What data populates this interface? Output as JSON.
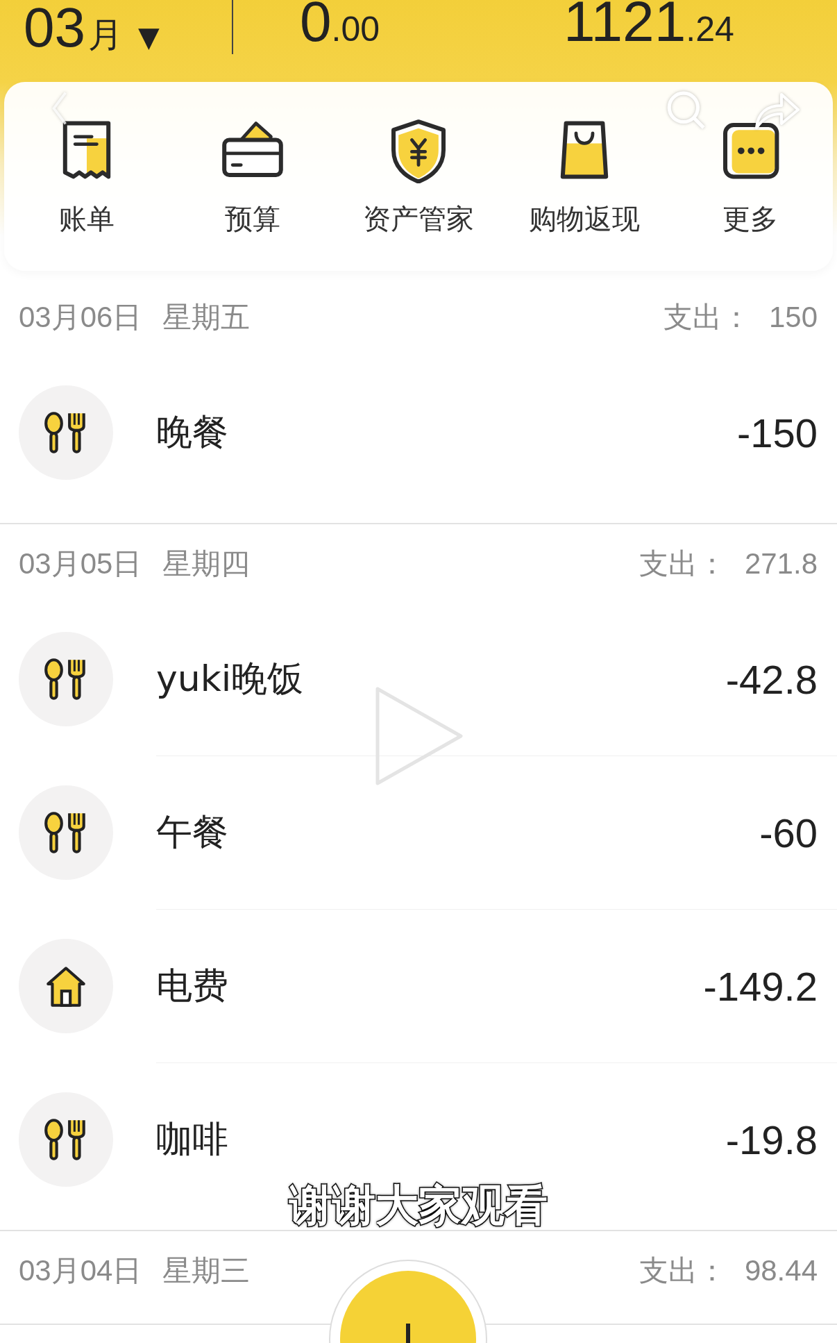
{
  "header": {
    "month": "03",
    "month_unit": "月",
    "caret": "▼",
    "income": {
      "int": "0",
      "dec": ".00"
    },
    "balance": {
      "int": "1121",
      "dec": ".24"
    }
  },
  "shortcuts": [
    {
      "label": "账单",
      "kind": "receipt"
    },
    {
      "label": "预算",
      "kind": "wallet"
    },
    {
      "label": "资产管家",
      "kind": "shield"
    },
    {
      "label": "购物返现",
      "kind": "bag"
    },
    {
      "label": "更多",
      "kind": "more"
    }
  ],
  "days": [
    {
      "date": "03月06日",
      "weekday": "星期五",
      "expense_label": "支出：",
      "expense": "150",
      "entries": [
        {
          "kind": "dining",
          "title": "晚餐",
          "amount": "-150"
        }
      ]
    },
    {
      "date": "03月05日",
      "weekday": "星期四",
      "expense_label": "支出：",
      "expense": "271.8",
      "entries": [
        {
          "kind": "dining",
          "title": "yuki晚饭",
          "amount": "-42.8"
        },
        {
          "kind": "dining",
          "title": "午餐",
          "amount": "-60"
        },
        {
          "kind": "home",
          "title": "电费",
          "amount": "-149.2"
        },
        {
          "kind": "dining",
          "title": "咖啡",
          "amount": "-19.8"
        }
      ]
    },
    {
      "date": "03月04日",
      "weekday": "星期三",
      "expense_label": "支出：",
      "expense": "98.44"
    }
  ],
  "subtitle": "谢谢大家观看"
}
